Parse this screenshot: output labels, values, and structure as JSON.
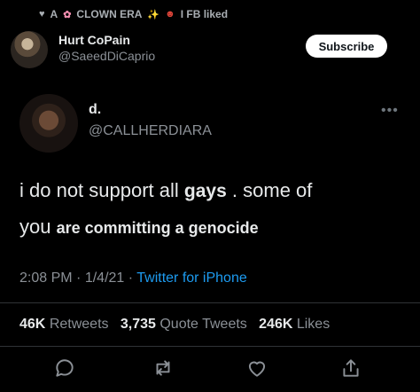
{
  "liked_by": {
    "prefix": "A",
    "name": "CLOWN ERA",
    "suffix": "I FB liked"
  },
  "header": {
    "name": "Hurt CoPain",
    "handle": "@SaeedDiCaprio",
    "subscribe_label": "Subscribe"
  },
  "tweet": {
    "author_name": "d.",
    "author_handle": "@CALLHERDIARA",
    "more_label": "•••",
    "line1_a": "i do not support all",
    "line1_word": "gays",
    "line1_b": ". some of",
    "line2_a": "you",
    "line2_b": "are committing a genocide",
    "time": "2:08 PM",
    "date": "1/4/21",
    "source": "Twitter for iPhone"
  },
  "stats": {
    "retweets_count": "46K",
    "retweets_label": "Retweets",
    "quotes_count": "3,735",
    "quotes_label": "Quote Tweets",
    "likes_count": "246K",
    "likes_label": "Likes"
  },
  "icons": [
    "heart-icon",
    "flower-icon",
    "sparkles-icon",
    "clown-icon",
    "reply-icon",
    "retweet-icon",
    "like-icon",
    "share-icon",
    "more-icon"
  ],
  "colors": {
    "background": "#000000",
    "link": "#1d9bf0",
    "muted": "#8b9096",
    "subscribe_bg": "#ffffff"
  }
}
